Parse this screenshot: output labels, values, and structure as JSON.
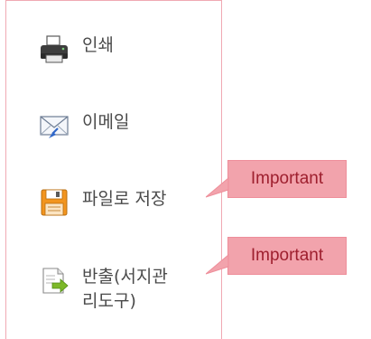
{
  "menu": {
    "items": [
      {
        "label": "인쇄",
        "icon": "printer-icon"
      },
      {
        "label": "이메일",
        "icon": "email-icon"
      },
      {
        "label": "파일로 저장",
        "icon": "save-file-icon"
      },
      {
        "label": "반출(서지관\n리도구)",
        "icon": "export-icon"
      }
    ]
  },
  "callouts": [
    {
      "text": "Important"
    },
    {
      "text": "Important"
    }
  ],
  "colors": {
    "panel_border": "#f0a9b3",
    "callout_fill": "#f2a3ac",
    "callout_text": "#9e1f2e",
    "label_text": "#4a4a4a"
  }
}
